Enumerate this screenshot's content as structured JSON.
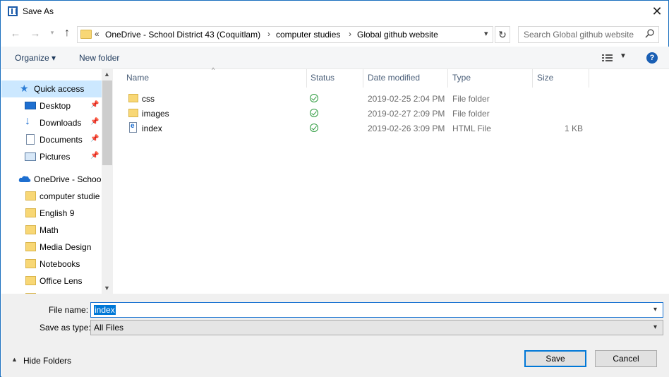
{
  "window": {
    "title": "Save As"
  },
  "address": {
    "prefix": "«",
    "crumbs": [
      "OneDrive - School District 43 (Coquitlam)",
      "computer studies",
      "Global github website"
    ],
    "separator": "›"
  },
  "search": {
    "placeholder": "Search Global github website"
  },
  "toolbar": {
    "organize": "Organize ▾",
    "new_folder": "New folder"
  },
  "navpane": {
    "items": [
      {
        "label": "Quick access",
        "pinned": false,
        "level": 0,
        "selected": true,
        "icon": "star-icon"
      },
      {
        "label": "Desktop",
        "pinned": true,
        "level": 1,
        "icon": "desktop-icon"
      },
      {
        "label": "Downloads",
        "pinned": true,
        "level": 1,
        "icon": "download-arrow-icon"
      },
      {
        "label": "Documents",
        "pinned": true,
        "level": 1,
        "icon": "document-icon"
      },
      {
        "label": "Pictures",
        "pinned": true,
        "level": 1,
        "icon": "pictures-icon"
      },
      {
        "label": "OneDrive - Schoo",
        "pinned": false,
        "level": 0,
        "icon": "cloud-icon"
      },
      {
        "label": "computer studie",
        "pinned": false,
        "level": 1,
        "icon": "folder-icon"
      },
      {
        "label": "English 9",
        "pinned": false,
        "level": 1,
        "icon": "folder-icon"
      },
      {
        "label": "Math",
        "pinned": false,
        "level": 1,
        "icon": "folder-icon"
      },
      {
        "label": "Media Design",
        "pinned": false,
        "level": 1,
        "icon": "folder-icon"
      },
      {
        "label": "Notebooks",
        "pinned": false,
        "level": 1,
        "icon": "folder-icon"
      },
      {
        "label": "Office Lens",
        "pinned": false,
        "level": 1,
        "icon": "folder-icon"
      }
    ]
  },
  "columns": {
    "name": "Name",
    "status": "Status",
    "date": "Date modified",
    "type": "Type",
    "size": "Size"
  },
  "files": [
    {
      "name": "css",
      "date": "2019-02-25 2:04 PM",
      "type": "File folder",
      "size": "",
      "icon": "folder-icon"
    },
    {
      "name": "images",
      "date": "2019-02-27 2:09 PM",
      "type": "File folder",
      "size": "",
      "icon": "folder-icon"
    },
    {
      "name": "index",
      "date": "2019-02-26 3:09 PM",
      "type": "HTML File",
      "size": "1 KB",
      "icon": "html-file-icon"
    }
  ],
  "form": {
    "file_name_label": "File name:",
    "file_name_value": "index",
    "save_type_label": "Save as type:",
    "save_type_value": "All Files"
  },
  "footer": {
    "hide_folders": "Hide Folders",
    "save": "Save",
    "cancel": "Cancel"
  },
  "colors": {
    "accent": "#0078d7",
    "selection": "#cce8ff",
    "folder": "#f8d775",
    "status_ok": "#2b9a3c"
  }
}
